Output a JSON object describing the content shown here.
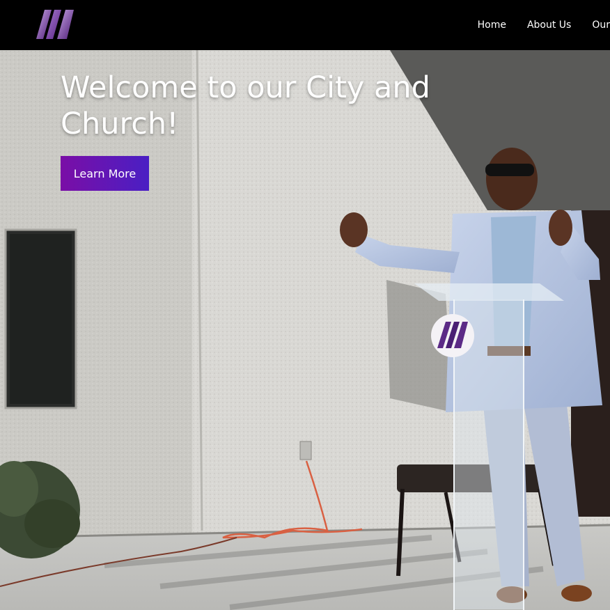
{
  "header": {
    "logo_icon": "church-logo-m",
    "nav": [
      {
        "label": "Home"
      },
      {
        "label": "About Us"
      },
      {
        "label": "Our"
      }
    ]
  },
  "hero": {
    "title": "Welcome to our City and Church!",
    "cta_label": "Learn More",
    "image": "pastor-preaching-at-podium-outdoors"
  },
  "colors": {
    "header_bg": "#000000",
    "cta_start": "#7a0ea6",
    "cta_end": "#4a1fc4",
    "logo_purple": "#6a2b8f"
  }
}
